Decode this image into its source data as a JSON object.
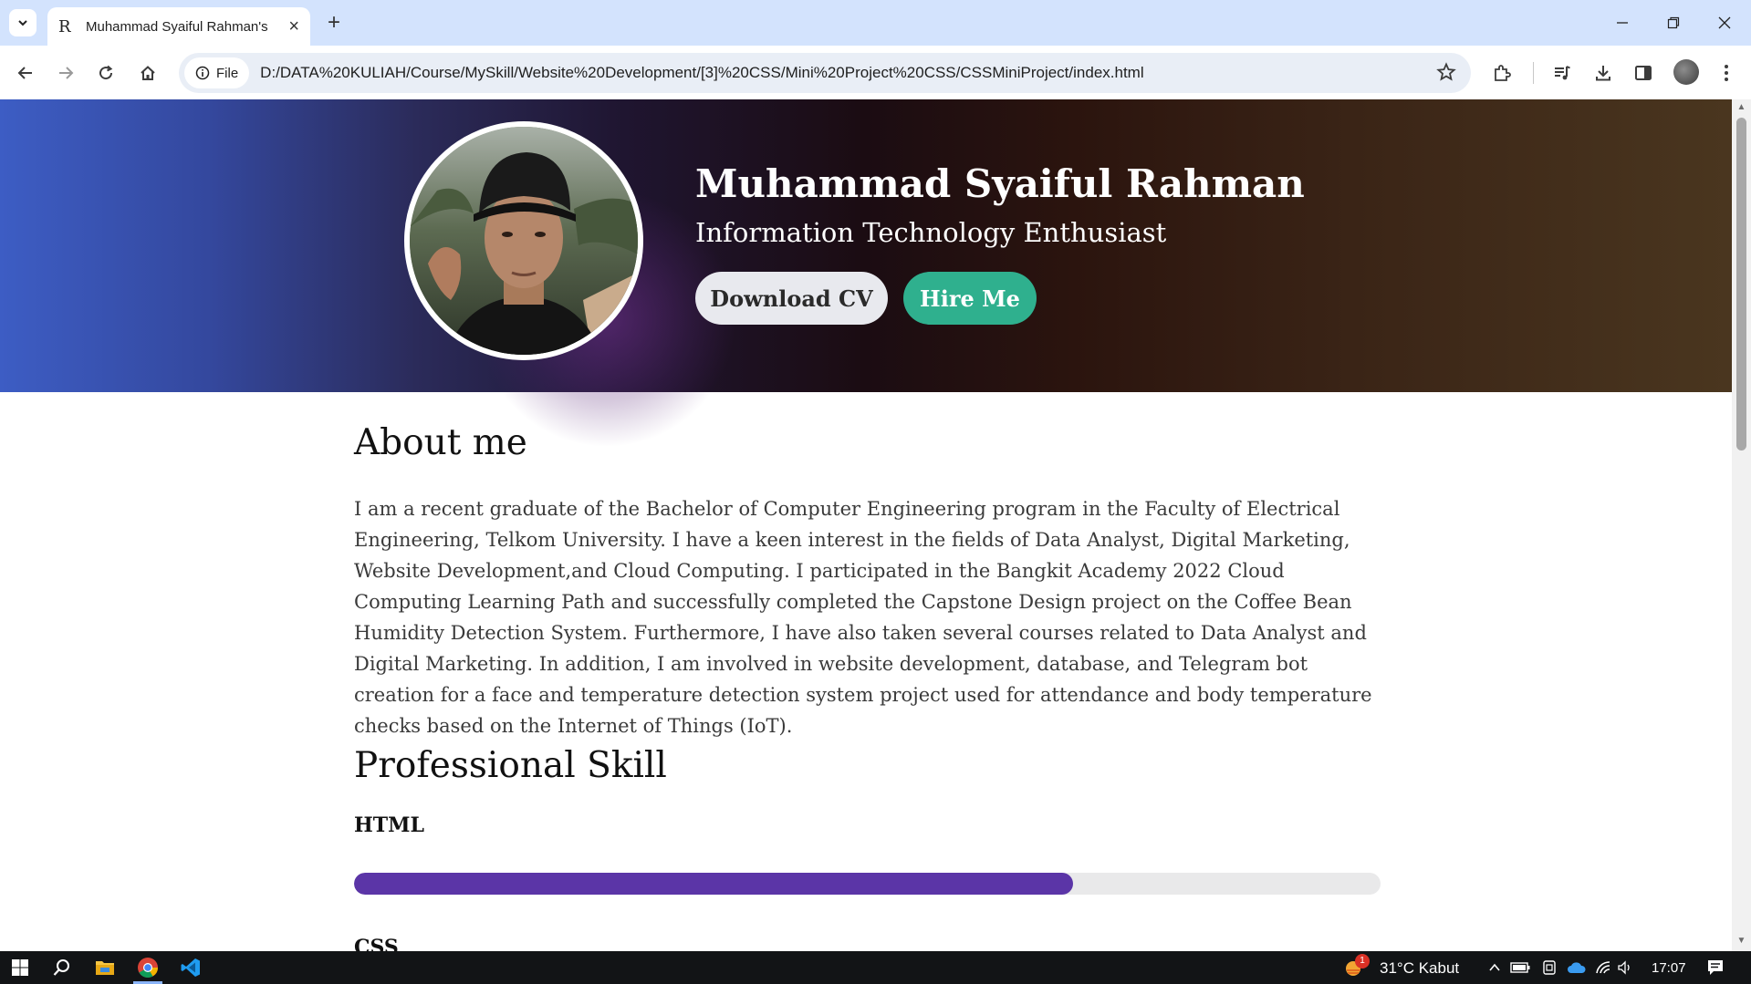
{
  "browser": {
    "tab_title": "Muhammad Syaiful Rahman's",
    "tab_favicon": "R",
    "new_tab": "+",
    "site_chip": "File",
    "url": "D:/DATA%20KULIAH/Course/MySkill/Website%20Development/[3]%20CSS/Mini%20Project%20CSS/CSSMiniProject/index.html"
  },
  "hero": {
    "name": "Muhammad Syaiful Rahman",
    "role": "Information Technology Enthusiast",
    "download_cv": "Download CV",
    "hire_me": "Hire Me"
  },
  "about": {
    "heading": "About me",
    "text": "I am a recent graduate of the Bachelor of Computer Engineering program in the Faculty of Electrical Engineering, Telkom University. I have a keen interest in the fields of Data Analyst, Digital Marketing, Website Development,and Cloud Computing. I participated in the Bangkit Academy 2022 Cloud Computing Learning Path and successfully completed the Capstone Design project on the Coffee Bean Humidity Detection System. Furthermore, I have also taken several courses related to Data Analyst and Digital Marketing. In addition, I am involved in website development, database, and Telegram bot creation for a face and temperature detection system project used for attendance and body temperature checks based on the Internet of Things (IoT)."
  },
  "skills": {
    "heading": "Professional Skill",
    "items": [
      {
        "label": "HTML",
        "level": 0.7
      },
      {
        "label": "CSS"
      }
    ]
  },
  "taskbar": {
    "weather": "31°C  Kabut",
    "weather_badge": "1",
    "time": "17:07"
  },
  "colors": {
    "hire_button": "#2fb08e",
    "skill_fill": "#5b35a7",
    "tabbar": "#d3e3fd"
  }
}
